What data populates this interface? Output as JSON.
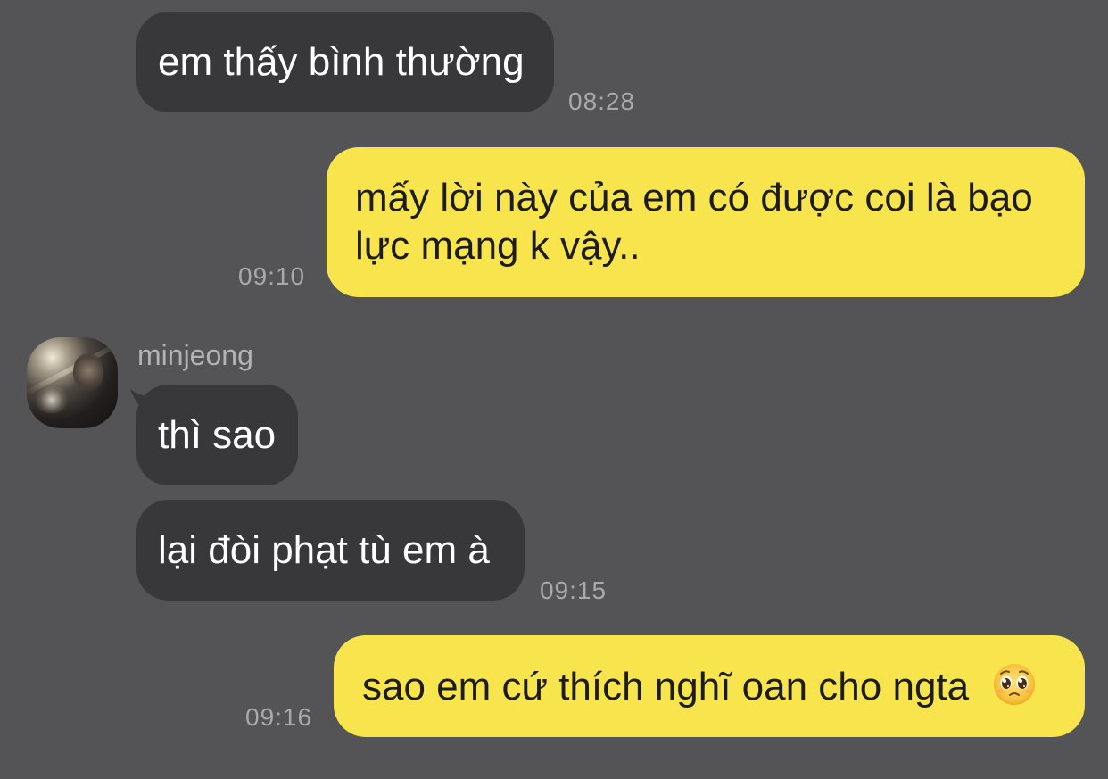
{
  "colors": {
    "background": "#545355",
    "incoming_bubble": "#38373a",
    "outgoing_bubble": "#f8e54e",
    "timestamp": "#a9a8ab"
  },
  "messages": [
    {
      "direction": "incoming",
      "text": "em thấy bình thường",
      "time": "08:28"
    },
    {
      "direction": "outgoing",
      "line1": "mấy lời này của em có được coi là bạo",
      "line2": "lực mạng k vậy..",
      "time": "09:10"
    },
    {
      "direction": "incoming",
      "sender": "minjeong",
      "avatar": "profile-photo",
      "text": "thì sao"
    },
    {
      "direction": "incoming",
      "text": "lại đòi phạt tù em à",
      "time": "09:15"
    },
    {
      "direction": "outgoing",
      "text": "sao em cứ thích nghĩ oan cho ngta",
      "emoji": "pleading-face",
      "time": "09:16"
    }
  ]
}
